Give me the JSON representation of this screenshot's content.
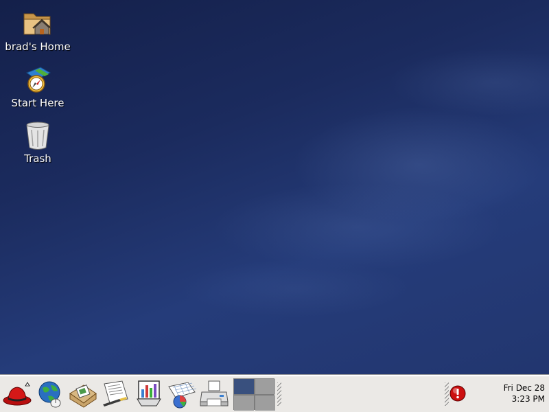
{
  "desktop": {
    "icons": [
      {
        "label": "brad's Home",
        "icon": "home-folder-icon"
      },
      {
        "label": "Start Here",
        "icon": "start-here-icon"
      },
      {
        "label": "Trash",
        "icon": "trash-icon"
      }
    ]
  },
  "panel": {
    "launchers": [
      {
        "name": "main-menu",
        "icon": "red-hat-icon"
      },
      {
        "name": "web-browser",
        "icon": "globe-mouse-icon"
      },
      {
        "name": "email",
        "icon": "mail-envelope-icon"
      },
      {
        "name": "word-processor",
        "icon": "writer-document-icon"
      },
      {
        "name": "presentation",
        "icon": "presentation-chart-icon"
      },
      {
        "name": "spreadsheet",
        "icon": "spreadsheet-icon"
      },
      {
        "name": "print-manager",
        "icon": "printer-icon"
      }
    ],
    "workspaces": {
      "count": 4,
      "active": 1
    },
    "alert_icon": "update-alert-icon",
    "clock": {
      "date": "Fri Dec 28",
      "time": "3:23 PM"
    }
  },
  "colors": {
    "desktop_bg": "#1e2f63",
    "panel_bg": "#ebe9e6",
    "workspace_active": "#39507e",
    "alert_red": "#cc1010"
  }
}
